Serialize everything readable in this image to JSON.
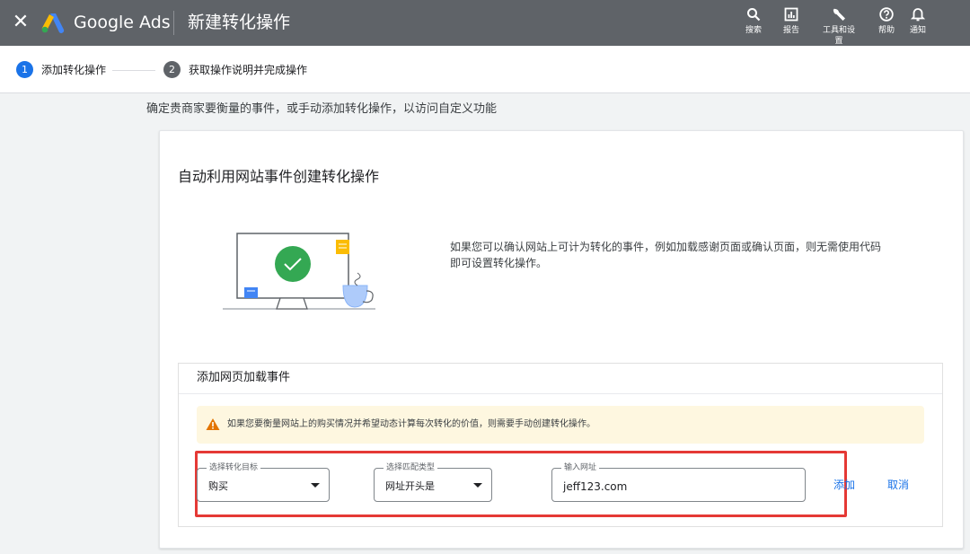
{
  "header": {
    "close_glyph": "✕",
    "brand": "Google Ads",
    "title": "新建转化操作",
    "tools": [
      {
        "icon": "search-icon",
        "label": "搜索"
      },
      {
        "icon": "reports-icon",
        "label": "报告"
      },
      {
        "icon": "wrench-icon",
        "label": "工具和设置"
      },
      {
        "icon": "help-icon",
        "label": "帮助"
      },
      {
        "icon": "bell-icon",
        "label": "通知"
      }
    ]
  },
  "stepper": {
    "steps": [
      {
        "number": "1",
        "label": "添加转化操作",
        "active": true
      },
      {
        "number": "2",
        "label": "获取操作说明并完成操作",
        "active": false
      }
    ]
  },
  "intro": "确定贵商家要衡量的事件，或手动添加转化操作，以访问自定义功能",
  "card": {
    "title": "自动利用网站事件创建转化操作",
    "description": "如果您可以确认网站上可计为转化的事件，例如加载感谢页面或确认页面，则无需使用代码即可设置转化操作。",
    "panel": {
      "title": "添加网页加载事件",
      "warning": "如果您要衡量网站上的购买情况并希望动态计算每次转化的价值，则需要手动创建转化操作。",
      "fields": {
        "goal": {
          "label": "选择转化目标",
          "value": "购买"
        },
        "match": {
          "label": "选择匹配类型",
          "value": "网址开头是"
        },
        "url": {
          "label": "输入网址",
          "value": "jeff123.com"
        }
      },
      "add_label": "添加",
      "cancel_label": "取消"
    }
  },
  "colors": {
    "topbar": "#5f6368",
    "accent": "#1a73e8",
    "highlight": "#e53935",
    "warning_bg": "#fef7e0",
    "warning_icon": "#e37400",
    "success": "#34a853"
  }
}
